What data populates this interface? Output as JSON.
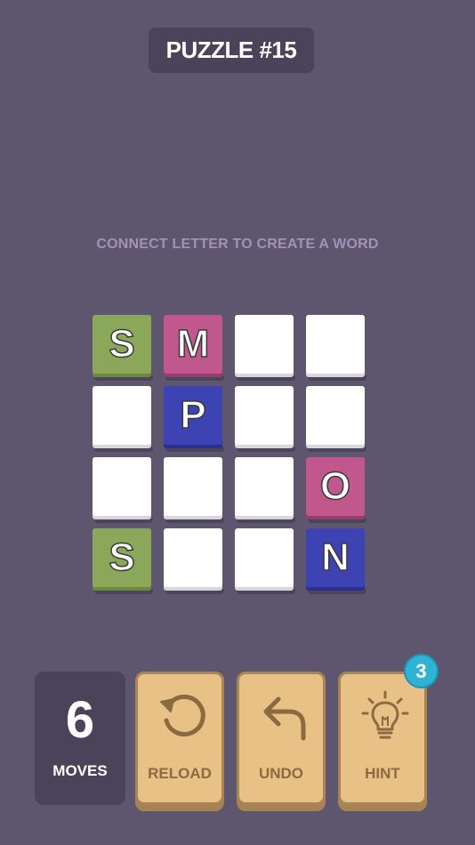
{
  "header": {
    "title": "PUZZLE #15"
  },
  "instruction": "CONNECT LETTER TO CREATE A WORD",
  "board": {
    "rows": [
      [
        {
          "letter": "S",
          "color": "green"
        },
        {
          "letter": "M",
          "color": "pink"
        },
        {
          "letter": "",
          "color": "empty"
        },
        {
          "letter": "",
          "color": "empty"
        }
      ],
      [
        {
          "letter": "",
          "color": "empty"
        },
        {
          "letter": "P",
          "color": "blue"
        },
        {
          "letter": "",
          "color": "empty"
        },
        {
          "letter": "",
          "color": "empty"
        }
      ],
      [
        {
          "letter": "",
          "color": "empty"
        },
        {
          "letter": "",
          "color": "empty"
        },
        {
          "letter": "",
          "color": "empty"
        },
        {
          "letter": "O",
          "color": "pink"
        }
      ],
      [
        {
          "letter": "S",
          "color": "green"
        },
        {
          "letter": "",
          "color": "empty"
        },
        {
          "letter": "",
          "color": "empty"
        },
        {
          "letter": "N",
          "color": "blue"
        }
      ]
    ]
  },
  "moves": {
    "count": "6",
    "label": "MOVES"
  },
  "buttons": {
    "reload": {
      "label": "RELOAD",
      "icon": "reload-icon"
    },
    "undo": {
      "label": "UNDO",
      "icon": "undo-icon"
    },
    "hint": {
      "label": "HINT",
      "icon": "lightbulb-icon",
      "badge": "3"
    }
  },
  "colors": {
    "background": "#5e566f",
    "green": "#8ba85a",
    "pink": "#c0578d",
    "blue": "#3d43b2",
    "button": "#e8c187",
    "badge": "#2fb3d5"
  }
}
